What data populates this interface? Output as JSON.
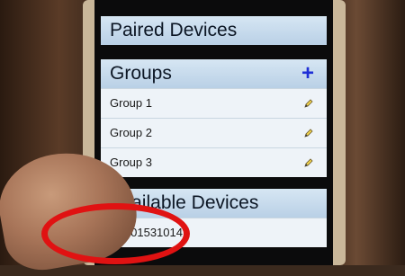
{
  "paired_devices": {
    "title": "Paired Devices"
  },
  "groups": {
    "title": "Groups",
    "add_label": "+",
    "items": [
      {
        "label": "Group 1"
      },
      {
        "label": "Group 2"
      },
      {
        "label": "Group 3"
      }
    ]
  },
  "available_devices": {
    "title": "Available Devices",
    "items": [
      {
        "label": "08B01531014"
      }
    ]
  },
  "colors": {
    "header_bg": "#c9dcec",
    "add_icon": "#1f2fd6",
    "highlight_ellipse": "#e01212"
  }
}
